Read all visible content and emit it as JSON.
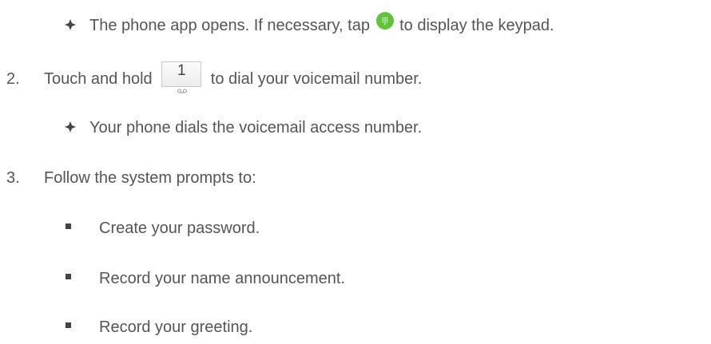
{
  "lines": {
    "step1_result": {
      "before": "The phone app opens. If necessary, tap ",
      "after": " to display the keypad.",
      "icon": "dialpad-icon"
    },
    "step2": {
      "number": "2.",
      "before": "Touch and hold ",
      "key_digit": "1",
      "key_icon": "voicemail-icon",
      "after": " to dial your voicemail number."
    },
    "step2_result": {
      "text": "Your phone dials the voicemail access number."
    },
    "step3": {
      "number": "3.",
      "text": "Follow the system prompts to:"
    },
    "step3_items": [
      "Create your password.",
      "Record your name announcement.",
      "Record your greeting."
    ]
  },
  "colors": {
    "text": "#555555",
    "dial_icon": "#62c23a",
    "bullet": "#444444"
  }
}
